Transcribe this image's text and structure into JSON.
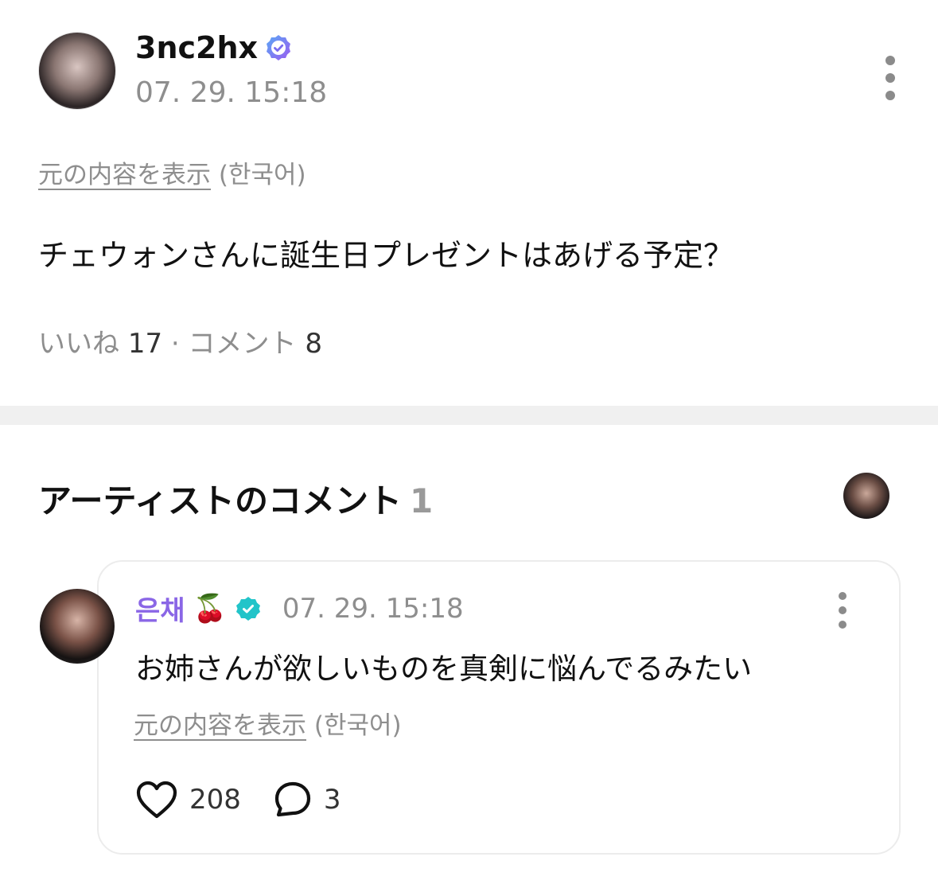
{
  "post": {
    "username": "3nc2hx",
    "timestamp": "07. 29. 15:18",
    "translation_link": "元の内容を表示",
    "translation_lang": "(한국어)",
    "body": "チェウォンさんに誕生日プレゼントはあげる予定？",
    "stats": {
      "likes_label": "いいね",
      "likes_count": "17",
      "separator": "·",
      "comments_label": "コメント",
      "comments_count": "8"
    }
  },
  "artist_comments": {
    "title": "アーティストのコメント",
    "count": "1",
    "comment": {
      "author": "은채",
      "author_emoji": "🍒",
      "timestamp": "07. 29. 15:18",
      "body": "お姉さんが欲しいものを真剣に悩んでるみたい",
      "translation_link": "元の内容を表示",
      "translation_lang": "(한국어)",
      "likes": "208",
      "replies": "3"
    }
  },
  "colors": {
    "artist_name": "#8a66e6",
    "verified_user_badge": "#7a6cf0",
    "artist_badge": "#22c4c9",
    "muted_text": "#8e8e8e",
    "divider": "#f0f0f0"
  },
  "icons": {
    "post_verified": "verified-badge-icon",
    "artist_verified": "artist-badge-icon",
    "more": "kebab-menu-icon",
    "like": "heart-icon",
    "reply": "speech-bubble-icon"
  }
}
